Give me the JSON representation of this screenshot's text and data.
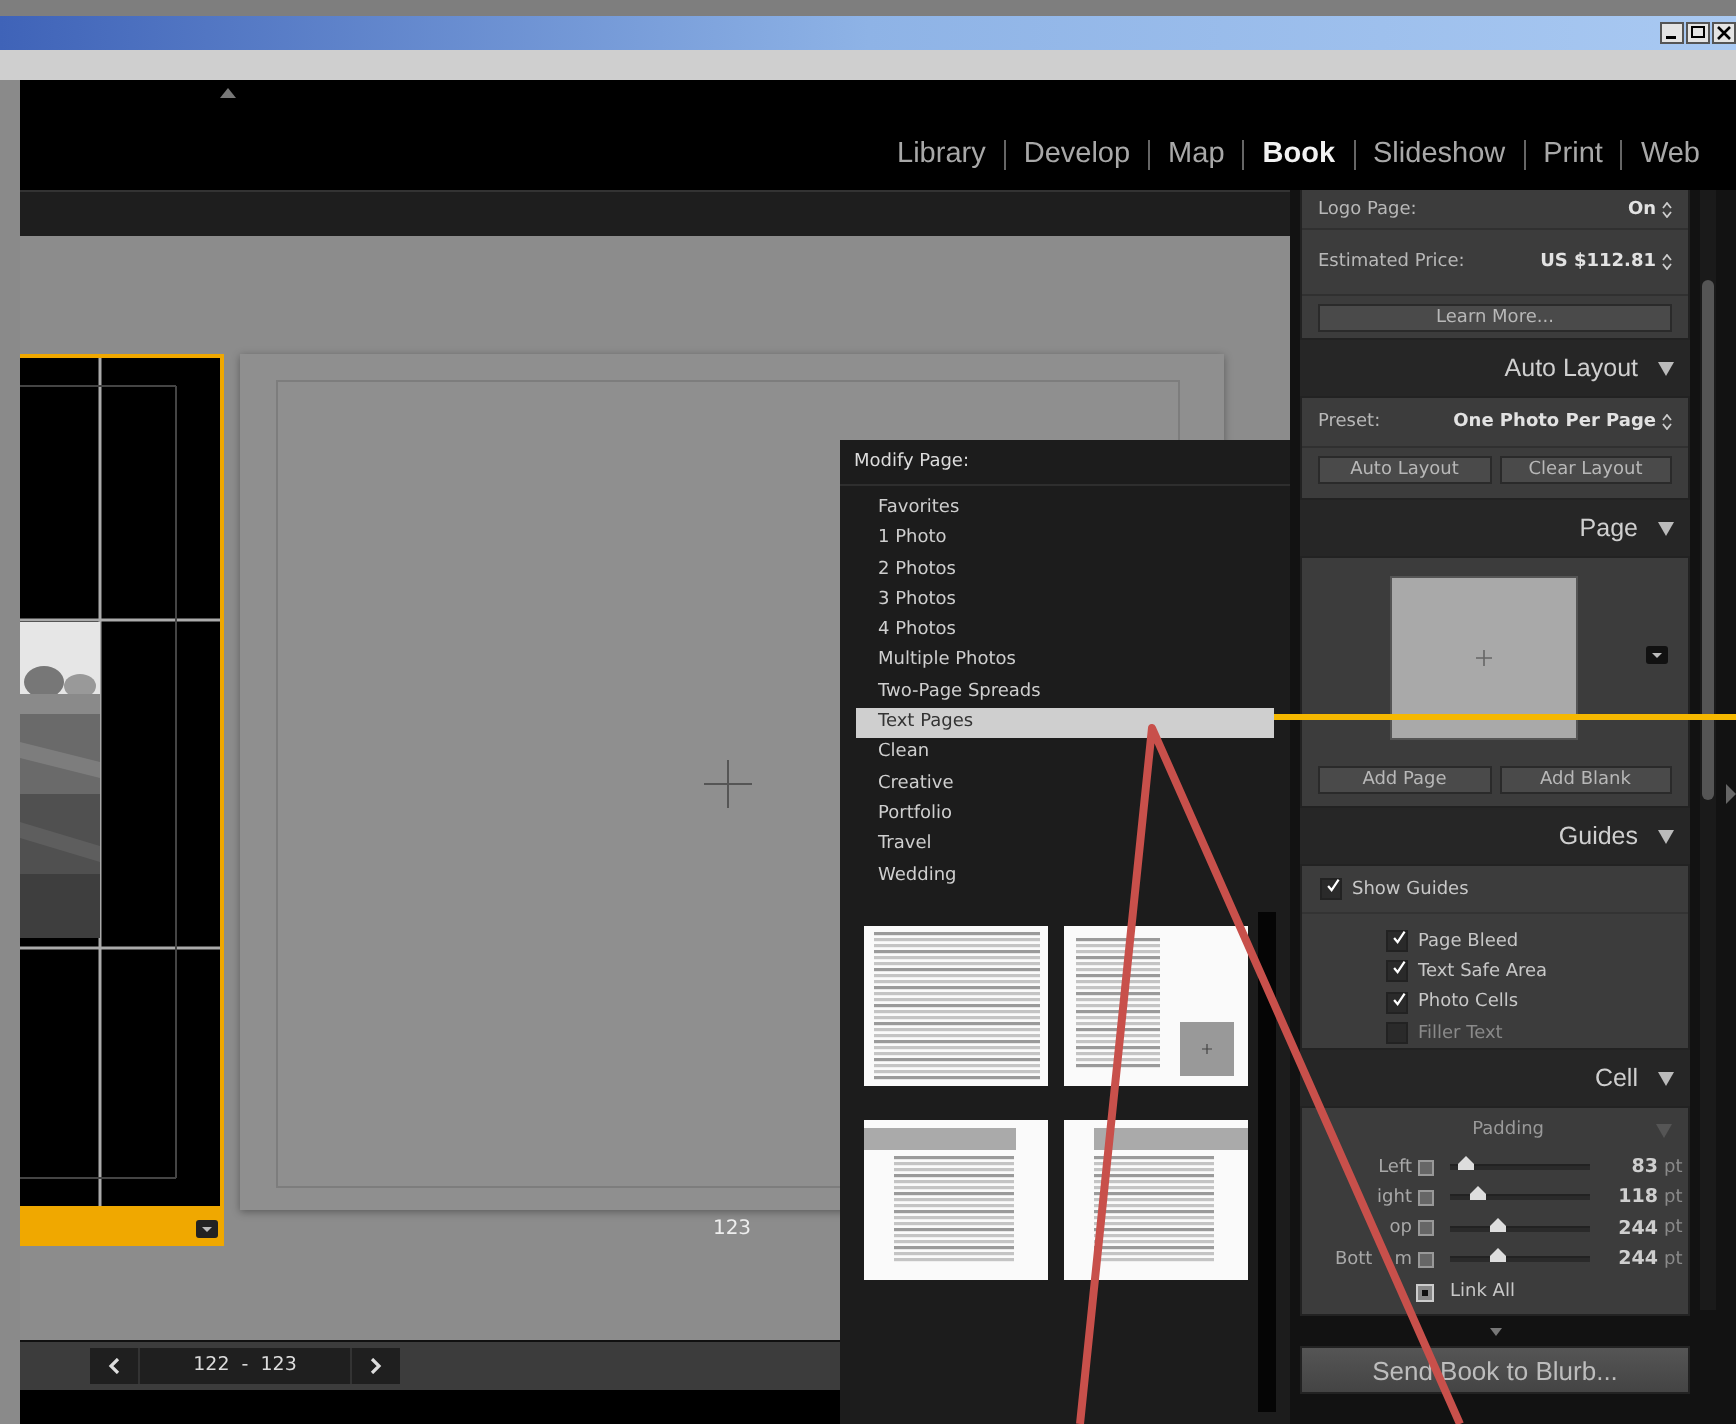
{
  "modules": [
    {
      "label": "Library",
      "selected": false
    },
    {
      "label": "Develop",
      "selected": false
    },
    {
      "label": "Map",
      "selected": false
    },
    {
      "label": "Book",
      "selected": true
    },
    {
      "label": "Slideshow",
      "selected": false
    },
    {
      "label": "Print",
      "selected": false
    },
    {
      "label": "Web",
      "selected": false
    }
  ],
  "canvas": {
    "page_number": "123",
    "page_range": "122  -  123"
  },
  "modify_menu": {
    "title": "Modify Page:",
    "items": [
      {
        "label": "Favorites",
        "selected": false
      },
      {
        "label": "1 Photo",
        "selected": false
      },
      {
        "label": "2 Photos",
        "selected": false
      },
      {
        "label": "3 Photos",
        "selected": false
      },
      {
        "label": "4 Photos",
        "selected": false
      },
      {
        "label": "Multiple Photos",
        "selected": false
      },
      {
        "label": "Two-Page Spreads",
        "selected": false
      },
      {
        "label": "Text Pages",
        "selected": true
      },
      {
        "label": "Clean",
        "selected": false
      },
      {
        "label": "Creative",
        "selected": false
      },
      {
        "label": "Portfolio",
        "selected": false
      },
      {
        "label": "Travel",
        "selected": false
      },
      {
        "label": "Wedding",
        "selected": false
      }
    ],
    "thumbnails": [
      {
        "kind": "full-text"
      },
      {
        "kind": "text-photo"
      },
      {
        "kind": "header-left"
      },
      {
        "kind": "header-right"
      }
    ]
  },
  "book_settings": {
    "rows": [
      {
        "label": "Logo Page:",
        "value": "On"
      },
      {
        "label": "Estimated Price:",
        "value": "US $112.81"
      }
    ],
    "button": "Learn More..."
  },
  "auto_layout": {
    "title": "Auto Layout",
    "preset_label": "Preset:",
    "preset": "One Photo Per Page",
    "buttons": [
      "Auto Layout",
      "Clear Layout"
    ]
  },
  "page": {
    "title": "Page",
    "buttons": [
      "Add Page",
      "Add Blank"
    ]
  },
  "guides": {
    "title": "Guides",
    "show": {
      "label": "Show Guides",
      "checked": true
    },
    "items": [
      {
        "label": "Page Bleed",
        "checked": true
      },
      {
        "label": "Text Safe Area",
        "checked": true
      },
      {
        "label": "Photo Cells",
        "checked": true
      },
      {
        "label": "Filler Text",
        "checked": false
      }
    ]
  },
  "cell": {
    "title": "Cell",
    "group": "Padding",
    "sliders": [
      {
        "label": "Left",
        "level": 0.12,
        "value": "83",
        "unit": "pt"
      },
      {
        "label": "ight",
        "level": 0.2,
        "value": "118",
        "unit": "pt"
      },
      {
        "label": "op",
        "level": 0.34,
        "value": "244",
        "unit": "pt"
      },
      {
        "label": "Bott",
        "label_tail": "m",
        "level": 0.34,
        "value": "244",
        "unit": "pt"
      }
    ],
    "link_all": {
      "label": "Link All",
      "checked": true
    }
  },
  "send_button": "Send Book to Blurb..."
}
